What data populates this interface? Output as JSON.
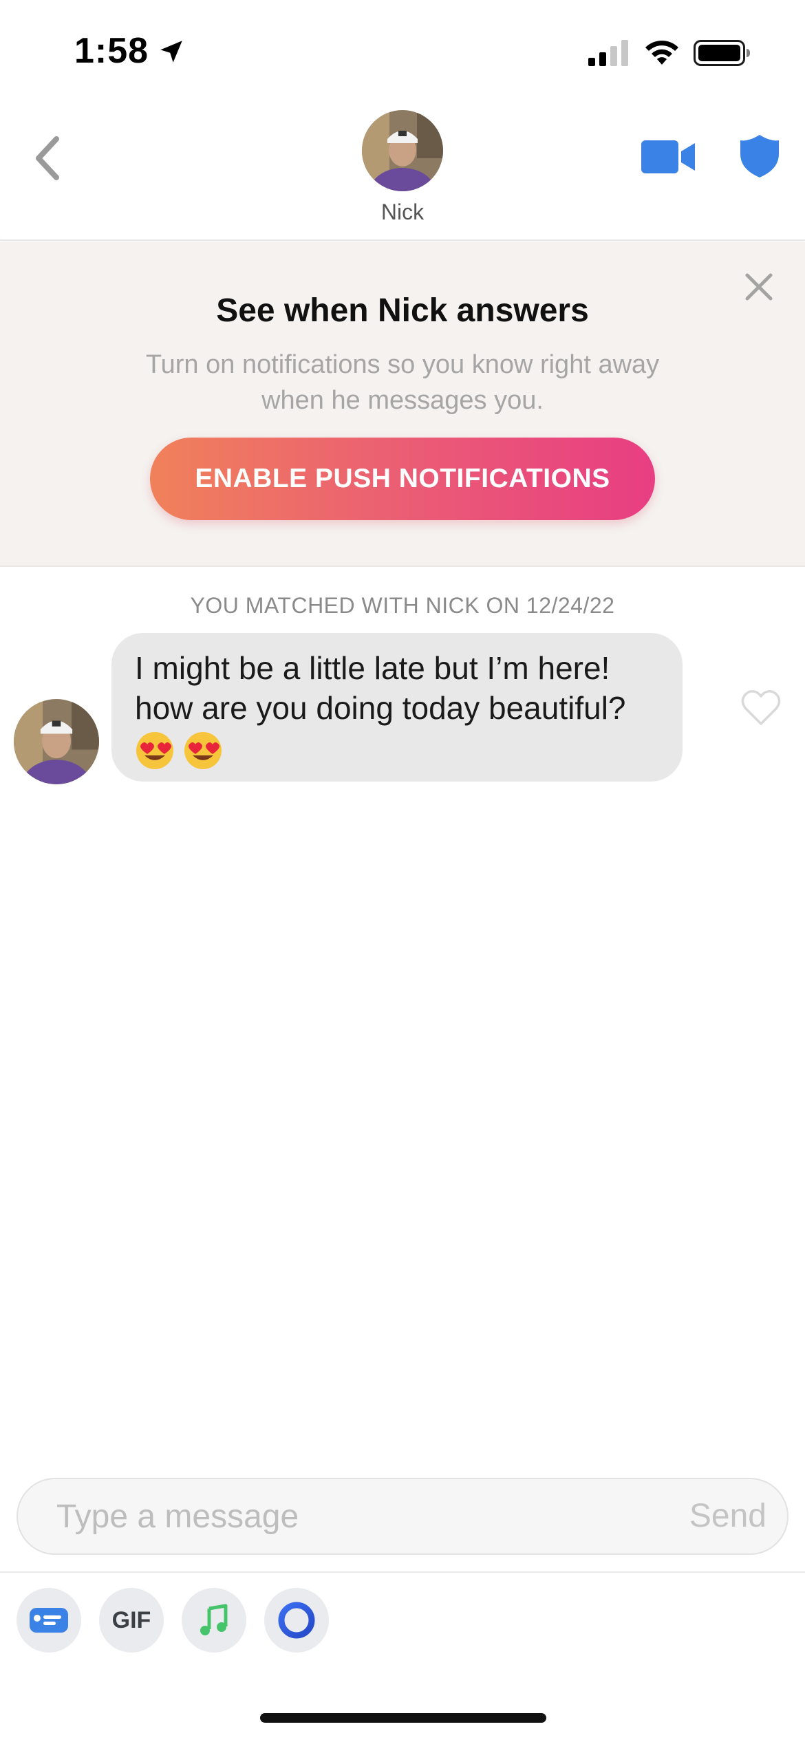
{
  "status_bar": {
    "time": "1:58"
  },
  "header": {
    "name": "Nick"
  },
  "notification": {
    "title": "See when Nick answers",
    "body": "Turn on notifications so you know right away when he messages you.",
    "button": "ENABLE PUSH NOTIFICATIONS"
  },
  "chat": {
    "match_note": "YOU MATCHED WITH NICK ON 12/24/22",
    "messages": [
      {
        "sender": "Nick",
        "text": "I might be a little late but I’m here! how are you doing today beautiful?",
        "emojis": [
          "heart-eyes",
          "heart-eyes"
        ]
      }
    ]
  },
  "composer": {
    "placeholder": "Type a message",
    "send_label": "Send"
  },
  "toolbar": {
    "gif_label": "GIF"
  },
  "colors": {
    "accent_blue": "#3b82e6",
    "gradient_start": "#f0815a",
    "gradient_end": "#e83e82",
    "banner_bg": "#f5f2f0"
  }
}
